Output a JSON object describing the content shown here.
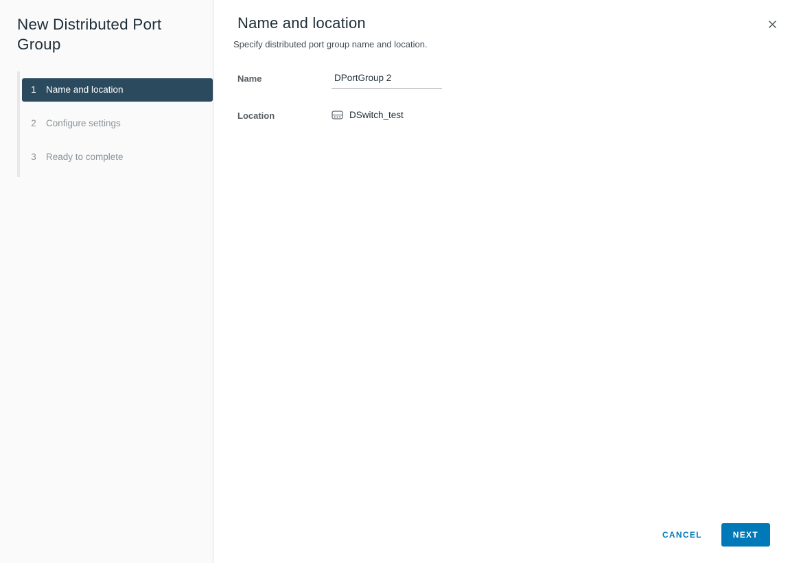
{
  "wizard": {
    "title": "New Distributed Port Group",
    "steps": [
      {
        "number": "1",
        "label": "Name and location"
      },
      {
        "number": "2",
        "label": "Configure settings"
      },
      {
        "number": "3",
        "label": "Ready to complete"
      }
    ]
  },
  "page": {
    "title": "Name and location",
    "subtitle": "Specify distributed port group name and location."
  },
  "form": {
    "name_label": "Name",
    "name_value": "DPortGroup 2",
    "location_label": "Location",
    "location_value": "DSwitch_test",
    "location_icon": "distributed-switch-icon"
  },
  "footer": {
    "cancel_label": "CANCEL",
    "next_label": "NEXT"
  },
  "colors": {
    "accent_blue": "#0079b8",
    "active_step_bg": "#2b4a5e",
    "sidebar_bg": "#fafafa"
  }
}
